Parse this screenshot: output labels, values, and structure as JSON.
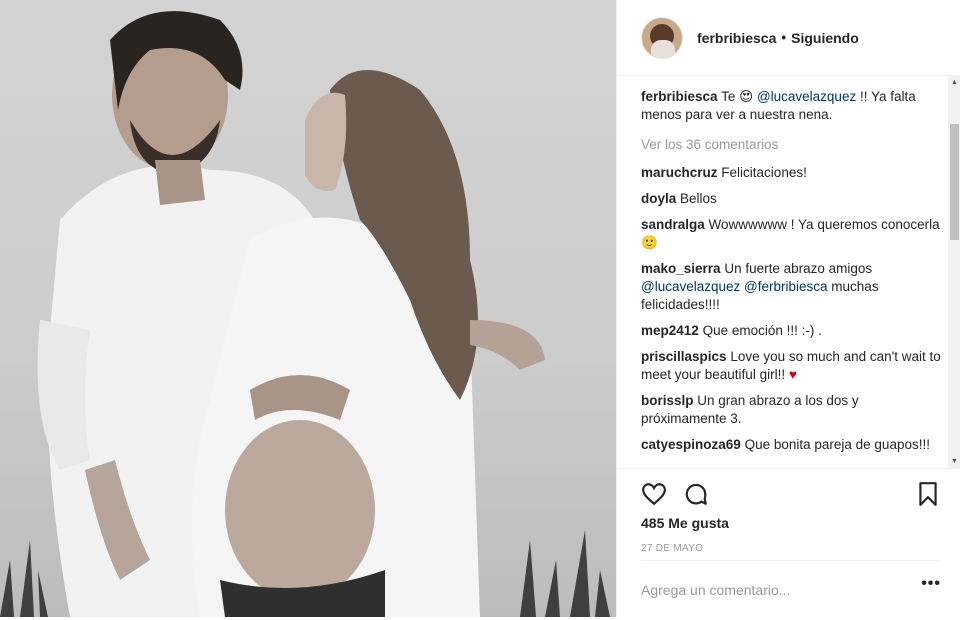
{
  "post": {
    "username": "ferbribiesca",
    "separator": "•",
    "follow_status": "Siguiendo",
    "caption": {
      "user": "ferbribiesca",
      "text_before": "Te",
      "emoji": "😍",
      "mention": "@lucavelazquez",
      "text_after": "!! Ya falta menos para ver a nuestra nena."
    },
    "view_all": "Ver los 36 comentarios",
    "comments": [
      {
        "user": "maruchcruz",
        "text": "Felicitaciones!"
      },
      {
        "user": "doyla",
        "text": "Bellos"
      },
      {
        "user": "sandralga",
        "text": "Wowwwwww ! Ya queremos conocerla 🙂"
      },
      {
        "user": "mako_sierra",
        "text_before": "Un fuerte abrazo amigos",
        "mention1": "@lucavelazquez",
        "mention2": "@ferbribiesca",
        "text_after": "muchas felicidades!!!!"
      },
      {
        "user": "mep2412",
        "text": "Que emoción !!! :-) ."
      },
      {
        "user": "priscillaspics",
        "text": "Love you so much and can't wait to meet your beautiful girl!!",
        "emoji": "♥"
      },
      {
        "user": "borisslp",
        "text": "Un gran abrazo a los dos y próximamente 3."
      },
      {
        "user": "catyespinoza69",
        "text": "Que bonita pareja de guapos!!!"
      }
    ],
    "likes": "485 Me gusta",
    "date": "27 DE MAYO",
    "add_comment_placeholder": "Agrega un comentario...",
    "more_options": "•••"
  },
  "icons": [
    "like-heart-icon",
    "comment-icon",
    "bookmark-icon",
    "more-options-icon"
  ],
  "colors": {
    "mention": "#003569",
    "muted": "#999999",
    "heart": "#d0021b"
  }
}
